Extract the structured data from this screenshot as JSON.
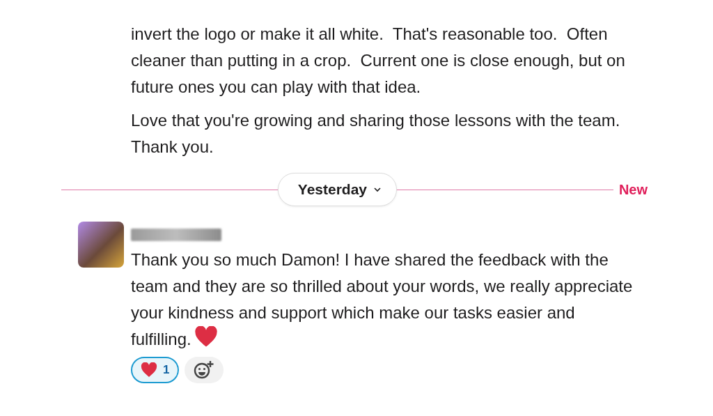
{
  "earlier_message": {
    "paragraphs": [
      "invert the logo or make it all white.  That's reasonable too.  Often cleaner than putting in a crop.  Current one is close enough, but on future ones you can play with that idea.",
      "Love that you're growing and sharing those lessons with the team.  Thank you."
    ]
  },
  "date_divider": {
    "label": "Yesterday",
    "new_label": "New"
  },
  "message": {
    "text": "Thank you so much Damon! I have shared the feedback with the team and they are so thrilled about your words, we really appreciate your kindness and support which make our tasks easier and fulfilling.",
    "reactions": [
      {
        "count": "1",
        "selected": true
      }
    ]
  }
}
